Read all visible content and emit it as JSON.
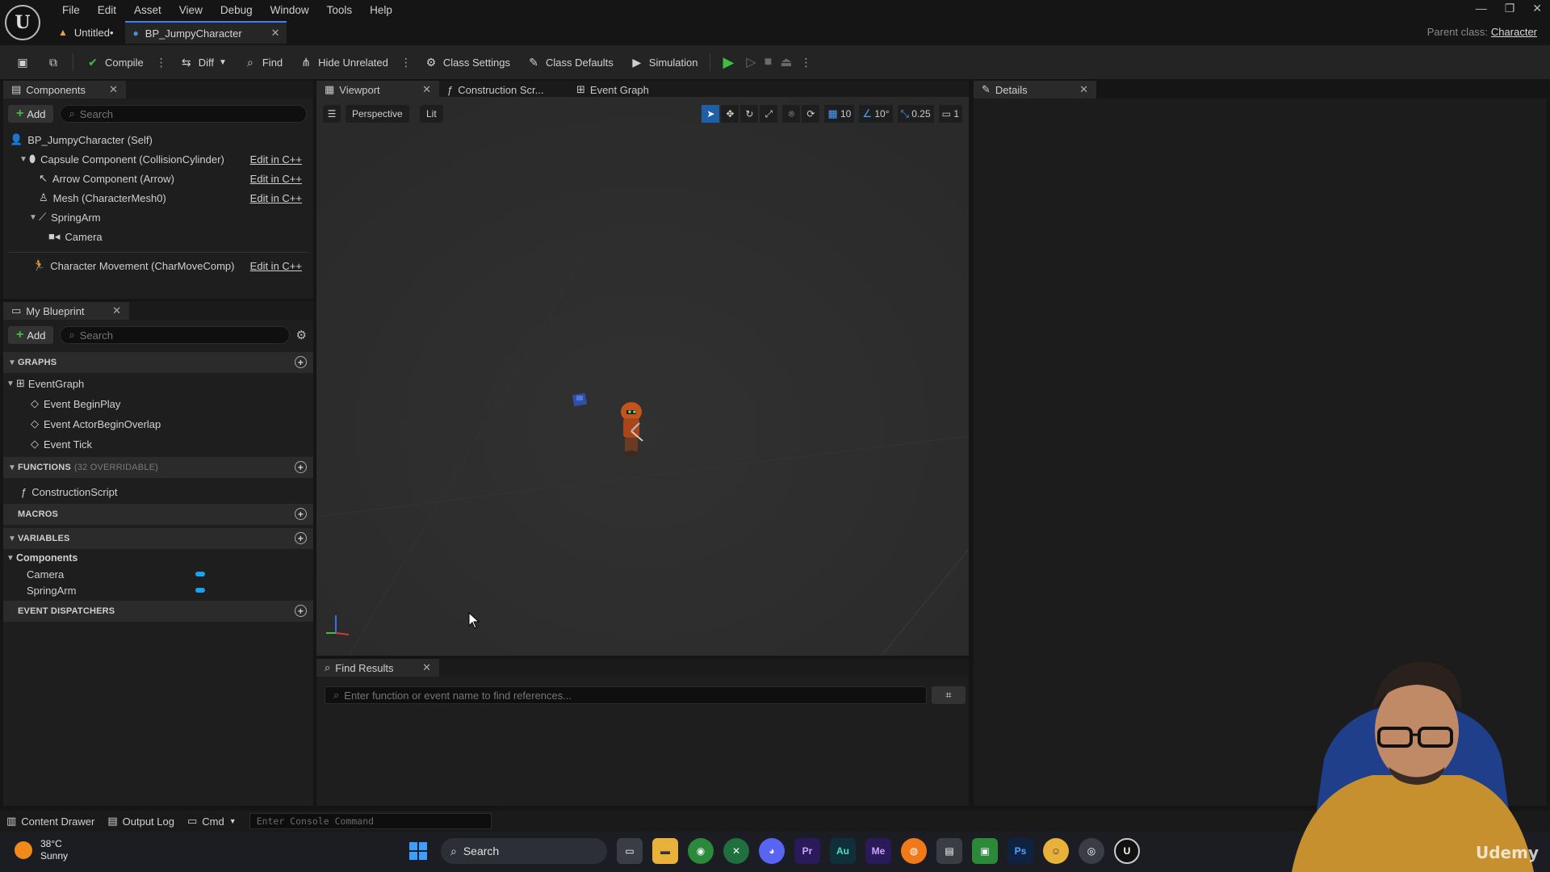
{
  "menu": [
    "File",
    "Edit",
    "Asset",
    "View",
    "Debug",
    "Window",
    "Tools",
    "Help"
  ],
  "doc_tabs": [
    {
      "label": "Untitled•"
    },
    {
      "label": "BP_JumpyCharacter"
    }
  ],
  "parent_class": {
    "label": "Parent class:",
    "value": "Character"
  },
  "toolbar": {
    "compile": "Compile",
    "diff": "Diff",
    "find": "Find",
    "hide_unrelated": "Hide Unrelated",
    "class_settings": "Class Settings",
    "class_defaults": "Class Defaults",
    "simulation": "Simulation"
  },
  "components_panel": {
    "title": "Components",
    "add": "Add",
    "search_placeholder": "Search",
    "items": [
      {
        "label": "BP_JumpyCharacter (Self)",
        "edit": ""
      },
      {
        "label": "Capsule Component (CollisionCylinder)",
        "edit": "Edit in C++"
      },
      {
        "label": "Arrow Component (Arrow)",
        "edit": "Edit in C++"
      },
      {
        "label": "Mesh (CharacterMesh0)",
        "edit": "Edit in C++"
      },
      {
        "label": "SpringArm",
        "edit": ""
      },
      {
        "label": "Camera",
        "edit": ""
      },
      {
        "label": "Character Movement (CharMoveComp)",
        "edit": "Edit in C++"
      }
    ]
  },
  "my_blueprint": {
    "title": "My Blueprint",
    "add": "Add",
    "search_placeholder": "Search",
    "graphs_label": "GRAPHS",
    "event_graph": "EventGraph",
    "events": [
      "Event BeginPlay",
      "Event ActorBeginOverlap",
      "Event Tick"
    ],
    "functions_label": "FUNCTIONS",
    "functions_overridable": "(32 OVERRIDABLE)",
    "construction_script": "ConstructionScript",
    "macros_label": "MACROS",
    "variables_label": "VARIABLES",
    "components_category": "Components",
    "variables": [
      "Camera",
      "SpringArm"
    ],
    "event_dispatchers_label": "EVENT DISPATCHERS"
  },
  "editor_tabs": {
    "viewport": "Viewport",
    "construction": "Construction Scr...",
    "event_graph": "Event Graph"
  },
  "viewport": {
    "perspective": "Perspective",
    "lit": "Lit",
    "grid_snap": "10",
    "rot_snap": "10°",
    "scale_snap": "0.25",
    "camera_speed": "1"
  },
  "details": {
    "title": "Details"
  },
  "find_results": {
    "title": "Find Results",
    "placeholder": "Enter function or event name to find references..."
  },
  "statusbar": {
    "content_drawer": "Content Drawer",
    "output_log": "Output Log",
    "cmd": "Cmd",
    "console_placeholder": "Enter Console Command"
  },
  "taskbar": {
    "temp": "38°C",
    "weather": "Sunny",
    "search": "Search",
    "apps": [
      "Pr",
      "Au",
      "Me",
      "Ps"
    ]
  },
  "watermark": "Udemy"
}
